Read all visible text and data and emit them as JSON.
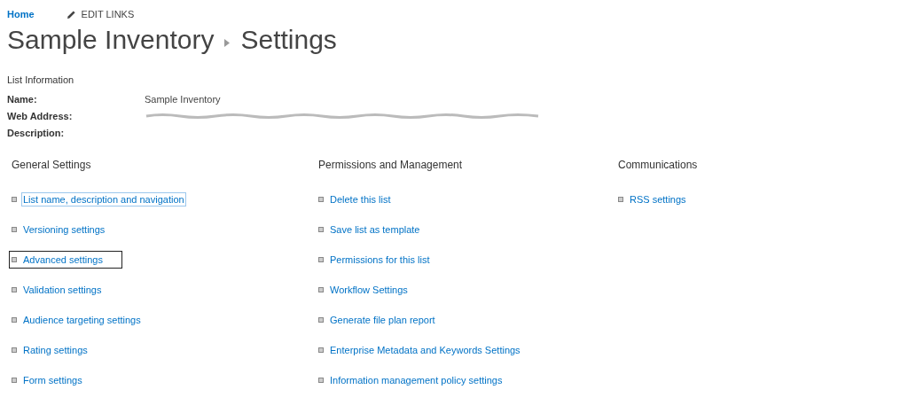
{
  "top_nav": {
    "home": "Home",
    "edit_links": "EDIT LINKS"
  },
  "title": {
    "list": "Sample Inventory",
    "page": "Settings"
  },
  "list_information": {
    "heading": "List Information",
    "fields": [
      {
        "label": "Name:",
        "value": "Sample Inventory",
        "redacted": false
      },
      {
        "label": "Web Address:",
        "redacted": true
      },
      {
        "label": "Description:",
        "redacted": false
      }
    ]
  },
  "sections": [
    {
      "heading": "General Settings",
      "links": [
        {
          "label": "List name, description and navigation",
          "focused": true,
          "highlighted": false
        },
        {
          "label": "Versioning settings",
          "focused": false,
          "highlighted": false
        },
        {
          "label": "Advanced settings",
          "focused": false,
          "highlighted": true
        },
        {
          "label": "Validation settings",
          "focused": false,
          "highlighted": false
        },
        {
          "label": "Audience targeting settings",
          "focused": false,
          "highlighted": false
        },
        {
          "label": "Rating settings",
          "focused": false,
          "highlighted": false
        },
        {
          "label": "Form settings",
          "focused": false,
          "highlighted": false
        }
      ]
    },
    {
      "heading": "Permissions and Management",
      "links": [
        {
          "label": "Delete this list",
          "focused": false,
          "highlighted": false
        },
        {
          "label": "Save list as template",
          "focused": false,
          "highlighted": false
        },
        {
          "label": "Permissions for this list",
          "focused": false,
          "highlighted": false
        },
        {
          "label": "Workflow Settings",
          "focused": false,
          "highlighted": false
        },
        {
          "label": "Generate file plan report",
          "focused": false,
          "highlighted": false
        },
        {
          "label": "Enterprise Metadata and Keywords Settings",
          "focused": false,
          "highlighted": false
        },
        {
          "label": "Information management policy settings",
          "focused": false,
          "highlighted": false
        }
      ]
    },
    {
      "heading": "Communications",
      "links": [
        {
          "label": "RSS settings",
          "focused": false,
          "highlighted": false
        }
      ]
    }
  ]
}
